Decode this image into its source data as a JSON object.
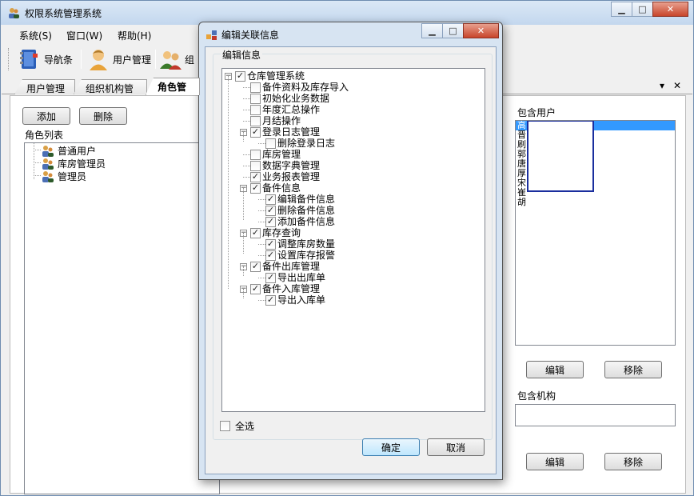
{
  "window": {
    "title": "权限系统管理系统"
  },
  "menu": [
    "系统(S)",
    "窗口(W)",
    "帮助(H)"
  ],
  "toolbar": [
    {
      "label": "导航条",
      "icon": "book-icon"
    },
    {
      "label": "用户管理",
      "icon": "user-icon"
    },
    {
      "label": "组",
      "icon": "users-group-icon"
    }
  ],
  "tabs": [
    {
      "label": "用户管理",
      "active": false
    },
    {
      "label": "组织机构管理",
      "active": false
    },
    {
      "label": "角色管理",
      "active": true
    }
  ],
  "role_panel": {
    "add_label": "添加",
    "delete_label": "删除",
    "list_label": "角色列表",
    "roles": [
      "普通用户",
      "库房管理员",
      "管理员"
    ]
  },
  "users_panel": {
    "title": "包含用户",
    "users": [
      "高",
      "晋",
      "刷",
      "郭",
      "唐",
      "厚",
      "宋",
      "崔",
      "胡"
    ],
    "edit_label": "编辑",
    "remove_label": "移除"
  },
  "org_panel": {
    "title": "包含机构",
    "edit_label": "编辑",
    "remove_label": "移除"
  },
  "dialog": {
    "title": "编辑关联信息",
    "group_label": "编辑信息",
    "tree": [
      {
        "label": "仓库管理系统",
        "level": 0,
        "checked": true,
        "expander": "−"
      },
      {
        "label": "备件资料及库存导入",
        "level": 1,
        "checked": false
      },
      {
        "label": "初始化业务数据",
        "level": 1,
        "checked": false
      },
      {
        "label": "年度汇总操作",
        "level": 1,
        "checked": false
      },
      {
        "label": "月结操作",
        "level": 1,
        "checked": false
      },
      {
        "label": "登录日志管理",
        "level": 1,
        "checked": true,
        "expander": "−"
      },
      {
        "label": "删除登录日志",
        "level": 2,
        "checked": false
      },
      {
        "label": "库房管理",
        "level": 1,
        "checked": false
      },
      {
        "label": "数据字典管理",
        "level": 1,
        "checked": false
      },
      {
        "label": "业务报表管理",
        "level": 1,
        "checked": true
      },
      {
        "label": "备件信息",
        "level": 1,
        "checked": true,
        "expander": "−"
      },
      {
        "label": "编辑备件信息",
        "level": 2,
        "checked": true
      },
      {
        "label": "删除备件信息",
        "level": 2,
        "checked": true
      },
      {
        "label": "添加备件信息",
        "level": 2,
        "checked": true
      },
      {
        "label": "库存查询",
        "level": 1,
        "checked": true,
        "expander": "−"
      },
      {
        "label": "调整库房数量",
        "level": 2,
        "checked": true
      },
      {
        "label": "设置库存报警",
        "level": 2,
        "checked": true
      },
      {
        "label": "备件出库管理",
        "level": 1,
        "checked": true,
        "expander": "−"
      },
      {
        "label": "导出出库单",
        "level": 2,
        "checked": true
      },
      {
        "label": "备件入库管理",
        "level": 1,
        "checked": true,
        "expander": "−"
      },
      {
        "label": "导出入库单",
        "level": 2,
        "checked": true
      }
    ],
    "select_all_label": "全选",
    "ok_label": "确定",
    "cancel_label": "取消"
  },
  "colors": {
    "selection": "#3399ff",
    "popup_border": "#1a2e9e",
    "title_bar": "#c3d7ee"
  }
}
